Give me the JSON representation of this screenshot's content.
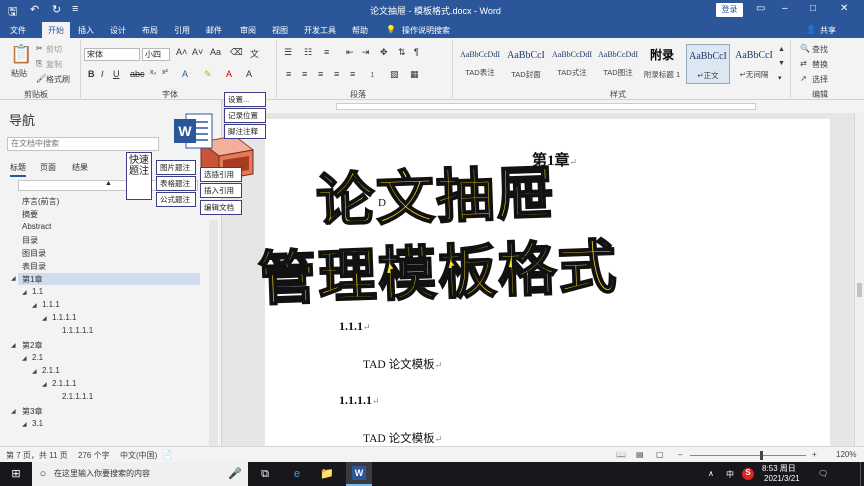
{
  "window": {
    "title": "论文抽屉 - 模板格式.docx - Word",
    "login": "登录",
    "share": "共享"
  },
  "tabs": [
    "文件",
    "开始",
    "插入",
    "设计",
    "布局",
    "引用",
    "邮件",
    "审阅",
    "视图",
    "开发工具",
    "帮助",
    "操作说明搜索"
  ],
  "ribbon": {
    "clipboard": {
      "label": "剪贴板",
      "paste": "粘贴",
      "cut": "剪切",
      "copy": "复制",
      "format_painter": "格式刷"
    },
    "font": {
      "label": "字体",
      "name": "宋体",
      "size": "小四"
    },
    "paragraph": {
      "label": "段落"
    },
    "styles": {
      "label": "样式",
      "items": [
        {
          "preview": "AaBbCcDdI",
          "name": "TAD表注"
        },
        {
          "preview": "AaBbCcI",
          "name": "TAD封面"
        },
        {
          "preview": "AaBbCcDdI",
          "name": "TAD式注"
        },
        {
          "preview": "AaBbCcDdI",
          "name": "TAD图注"
        },
        {
          "preview": "附录",
          "name": "附录标题 1"
        },
        {
          "preview": "AaBbCcI",
          "name": "↵正文"
        },
        {
          "preview": "AaBbCcI",
          "name": "↵无间隔"
        }
      ]
    },
    "editing": {
      "label": "编辑",
      "find": "查找",
      "replace": "替换",
      "select": "选择"
    }
  },
  "nav": {
    "title": "导航",
    "search_placeholder": "在文档中搜索",
    "tabs": [
      "标题",
      "页面",
      "结果"
    ],
    "items": [
      {
        "text": "序言(前言)"
      },
      {
        "text": "摘要"
      },
      {
        "text": "Abstract"
      },
      {
        "text": "目录"
      },
      {
        "text": "图目录"
      },
      {
        "text": "表目录"
      },
      {
        "text": "第1章"
      },
      {
        "text": "1.1"
      },
      {
        "text": "1.1.1"
      },
      {
        "text": "1.1.1.1"
      },
      {
        "text": "1.1.1.1.1"
      },
      {
        "text": "第2章"
      },
      {
        "text": "2.1"
      },
      {
        "text": "2.1.1"
      },
      {
        "text": "2.1.1.1"
      },
      {
        "text": "2.1.1.1.1"
      },
      {
        "text": "第3章"
      },
      {
        "text": "3.1"
      }
    ]
  },
  "document": {
    "chapter": "第1章",
    "lines": [
      "1.1.1",
      "TAD 论文模板",
      "1.1.1.1",
      "TAD 论文模板"
    ],
    "fragment": "D"
  },
  "overlay": {
    "settings": "设置...",
    "record_position": "记录位置",
    "footnote": "脚注注释",
    "quick_caption": "快速题注",
    "figure_caption": "图片题注",
    "table_caption": "表格题注",
    "equation_caption": "公式题注",
    "select_reference": "选插引用",
    "insert_reference": "插入引用",
    "edit_document": "编辑文档",
    "big_line_1": "论文抽屉",
    "big_line_2": "管理模板格式"
  },
  "status": {
    "page": "第 7 页，共 11 页",
    "words": "276 个字",
    "language": "中文(中国)",
    "zoom": "120%"
  },
  "taskbar": {
    "search_placeholder": "在这里输入你要搜索的内容",
    "ime": "中",
    "time": "8:53 周日",
    "date": "2021/3/21"
  },
  "colors": {
    "word_blue": "#2b579a",
    "title_yellow": "#ffdf1f"
  }
}
